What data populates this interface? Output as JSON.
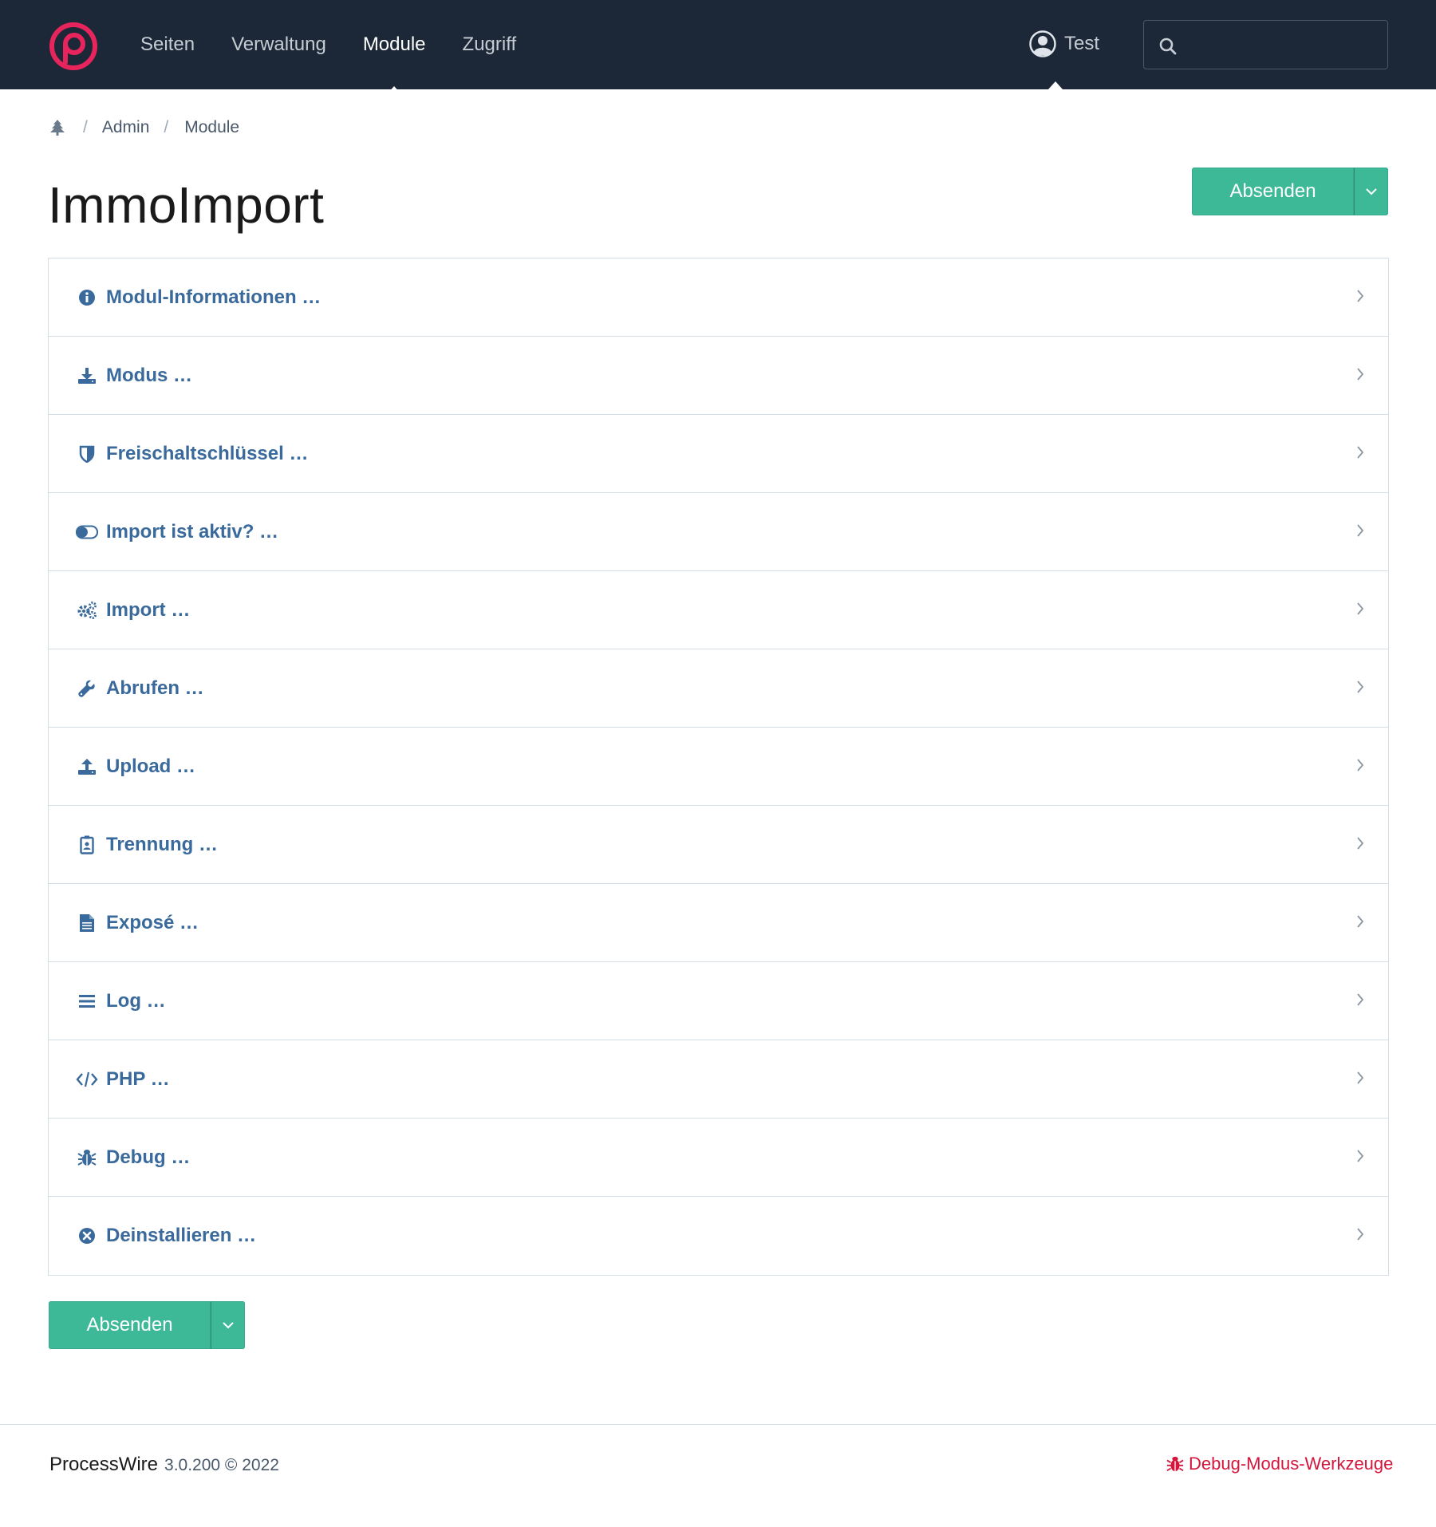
{
  "nav": {
    "items": [
      {
        "label": "Seiten",
        "active": false
      },
      {
        "label": "Verwaltung",
        "active": false
      },
      {
        "label": "Module",
        "active": true
      },
      {
        "label": "Zugriff",
        "active": false
      }
    ],
    "user": "Test",
    "search_placeholder": ""
  },
  "breadcrumb": {
    "items": [
      "Admin",
      "Module"
    ]
  },
  "page": {
    "title": "ImmoImport",
    "submit_label": "Absenden"
  },
  "sections": [
    {
      "label": "Modul-Informationen …",
      "icon": "info-circle-icon"
    },
    {
      "label": "Modus …",
      "icon": "download-icon"
    },
    {
      "label": "Freischaltschlüssel …",
      "icon": "shield-icon"
    },
    {
      "label": "Import ist aktiv? …",
      "icon": "toggle-icon"
    },
    {
      "label": "Import …",
      "icon": "gears-icon"
    },
    {
      "label": "Abrufen …",
      "icon": "wrench-icon"
    },
    {
      "label": "Upload …",
      "icon": "upload-icon"
    },
    {
      "label": "Trennung …",
      "icon": "badge-icon"
    },
    {
      "label": "Exposé …",
      "icon": "document-icon"
    },
    {
      "label": "Log …",
      "icon": "list-icon"
    },
    {
      "label": "PHP …",
      "icon": "code-icon"
    },
    {
      "label": "Debug …",
      "icon": "bug-icon"
    },
    {
      "label": "Deinstallieren …",
      "icon": "close-circle-icon"
    }
  ],
  "footer": {
    "brand": "ProcessWire",
    "version": "3.0.200 © 2022",
    "debug_link": "Debug-Modus-Werkzeuge"
  },
  "colors": {
    "nav_bg": "#1c2837",
    "accent_green": "#3eb998",
    "link_blue": "#3a6a9c",
    "brand_pink": "#e8245c",
    "debug_red": "#d5163c"
  }
}
